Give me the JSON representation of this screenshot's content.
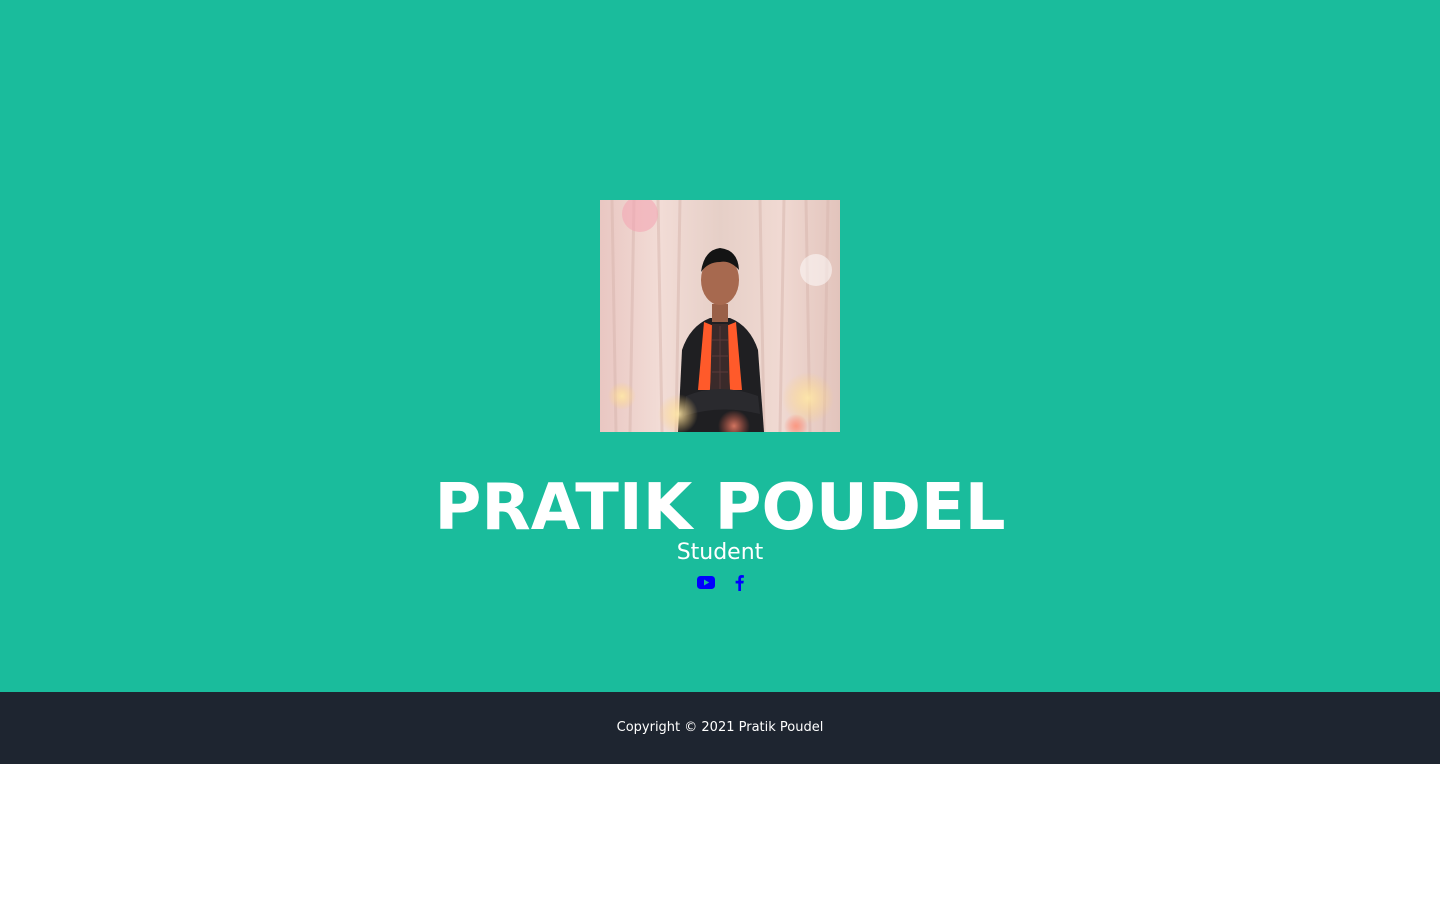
{
  "profile": {
    "name": "PRATIK POUDEL",
    "role": "Student",
    "photo_icon": "profile-photo"
  },
  "social": {
    "youtube_icon": "youtube-icon",
    "facebook_icon": "facebook-icon",
    "link_color": "#0000ff"
  },
  "footer": {
    "copyright": "Copyright © 2021 Pratik Poudel"
  },
  "colors": {
    "hero_bg": "#1abc9c",
    "footer_bg": "#1e2530",
    "text": "#ffffff"
  }
}
